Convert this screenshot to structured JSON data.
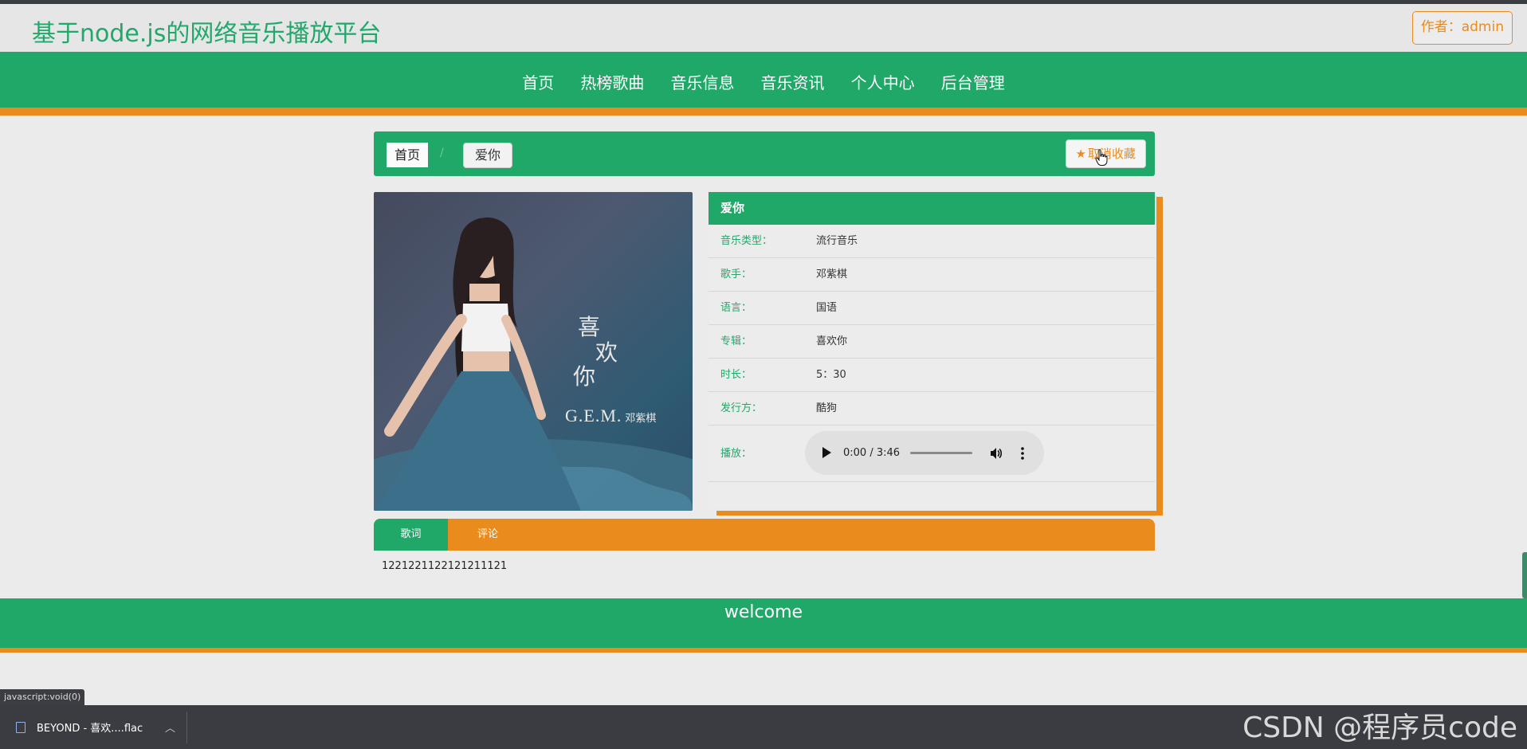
{
  "site": {
    "title": "基于node.js的网络音乐播放平台",
    "author_label": "作者：admin"
  },
  "nav": {
    "items": [
      "首页",
      "热榜歌曲",
      "音乐信息",
      "音乐资讯",
      "个人中心",
      "后台管理"
    ]
  },
  "breadcrumb": {
    "home": "首页",
    "separator": "/",
    "current": "爱你"
  },
  "favorite": {
    "label": "取消收藏",
    "icon": "star-icon"
  },
  "cover": {
    "line1": "喜",
    "line2": "欢",
    "line3": "你",
    "brand": "G.E.M.",
    "brand_cn": "邓紫棋"
  },
  "song": {
    "title": "爱你",
    "fields": [
      {
        "label": "音乐类型：",
        "value": "流行音乐"
      },
      {
        "label": "歌手：",
        "value": "邓紫棋"
      },
      {
        "label": "语言：",
        "value": "国语"
      },
      {
        "label": "专辑：",
        "value": "喜欢你"
      },
      {
        "label": "时长：",
        "value": "5：30"
      },
      {
        "label": "发行方：",
        "value": "酷狗"
      }
    ],
    "play_label": "播放：",
    "player": {
      "time": "0:00 / 3:46",
      "progress": 0
    }
  },
  "tabs": {
    "lyrics": "歌词",
    "comments": "评论"
  },
  "lyrics_text": "1221221122121211121",
  "footer": {
    "text": "welcome"
  },
  "status_url": "javascript:void(0)",
  "download": {
    "filename": "BEYOND - 喜欢....flac"
  },
  "watermark": "CSDN @程序员code",
  "colors": {
    "green": "#1fa868",
    "orange": "#ea8c1d"
  }
}
